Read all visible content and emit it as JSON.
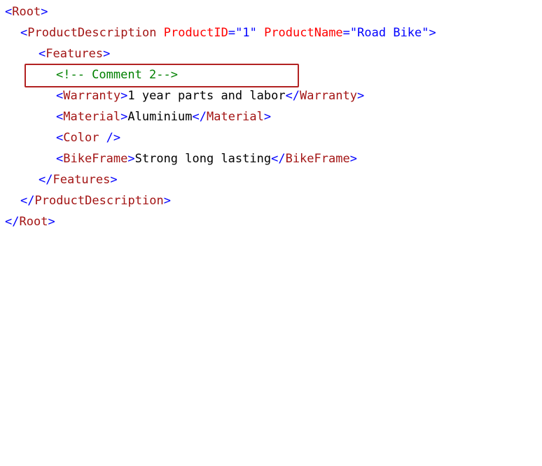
{
  "xml": {
    "line1": {
      "open": "<",
      "tag": "Root",
      "close": ">"
    },
    "line2": {
      "open": "<",
      "tag": "ProductDescription",
      "attr1_name": "ProductID",
      "attr1_eq": "=",
      "attr1_value": "\"1\"",
      "attr2_name": "ProductName",
      "attr2_eq": "=",
      "attr2_value": "\"Road Bike\"",
      "close": ">"
    },
    "line3": {
      "open": "<",
      "tag": "Features",
      "close": ">"
    },
    "line4": {
      "comment": "<!-- Comment 2-->"
    },
    "line5": {
      "open": "<",
      "tag": "Warranty",
      "close": ">",
      "text": "1 year parts and labor",
      "end_open": "</",
      "end_tag": "Warranty",
      "end_close": ">"
    },
    "line6": {
      "open": "<",
      "tag": "Material",
      "close": ">",
      "text": "Aluminium",
      "end_open": "</",
      "end_tag": "Material",
      "end_close": ">"
    },
    "line7": {
      "open": "<",
      "tag": "Color",
      "close": " />"
    },
    "line8": {
      "open": "<",
      "tag": "BikeFrame",
      "close": ">",
      "text": "Strong long lasting",
      "end_open": "</",
      "end_tag": "BikeFrame",
      "end_close": ">"
    },
    "line9": {
      "open": "</",
      "tag": "Features",
      "close": ">"
    },
    "line10": {
      "open": "</",
      "tag": "ProductDescription",
      "close": ">"
    },
    "line11": {
      "open": "</",
      "tag": "Root",
      "close": ">"
    }
  },
  "colors": {
    "bracket": "#0000ff",
    "tag": "#a31515",
    "attribute": "#ff0000",
    "attribute_value": "#0000ff",
    "text": "#000000",
    "comment": "#008000",
    "highlight_border": "#b22222"
  }
}
